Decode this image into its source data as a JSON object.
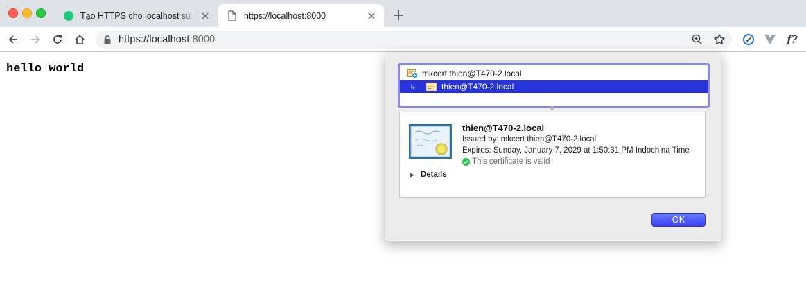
{
  "window": {
    "traffic_lights": [
      "close",
      "minimize",
      "zoom"
    ]
  },
  "tabs": [
    {
      "title": "Tạo HTTPS cho localhost sử dụ",
      "favicon": "green-circle-icon",
      "active": false
    },
    {
      "title": "https://localhost:8000",
      "favicon": "document-icon",
      "active": true
    }
  ],
  "toolbar": {
    "url_host": "https://localhost",
    "url_port": ":8000",
    "extensions": [
      "shield-extension-icon",
      "vue-extension-icon",
      "fx-extension-icon"
    ],
    "fx_label": "f?"
  },
  "page": {
    "body_text": "hello world"
  },
  "certificate_sheet": {
    "chain": {
      "root": "mkcert thien@T470-2.local",
      "leaf": "thien@T470-2.local"
    },
    "detail": {
      "name": "thien@T470-2.local",
      "issued_by": "Issued by: mkcert thien@T470-2.local",
      "expires": "Expires: Sunday, January 7, 2029 at 1:50:31 PM Indochina Time",
      "status": "This certificate is valid",
      "details_label": "Details"
    },
    "ok_label": "OK"
  },
  "colors": {
    "tabstrip": "#dee1e6",
    "selection": "#2634d9",
    "chain_focus_ring": "#8c88e8",
    "ok_button": "#3a3ef5",
    "valid_green": "#27c24c"
  }
}
